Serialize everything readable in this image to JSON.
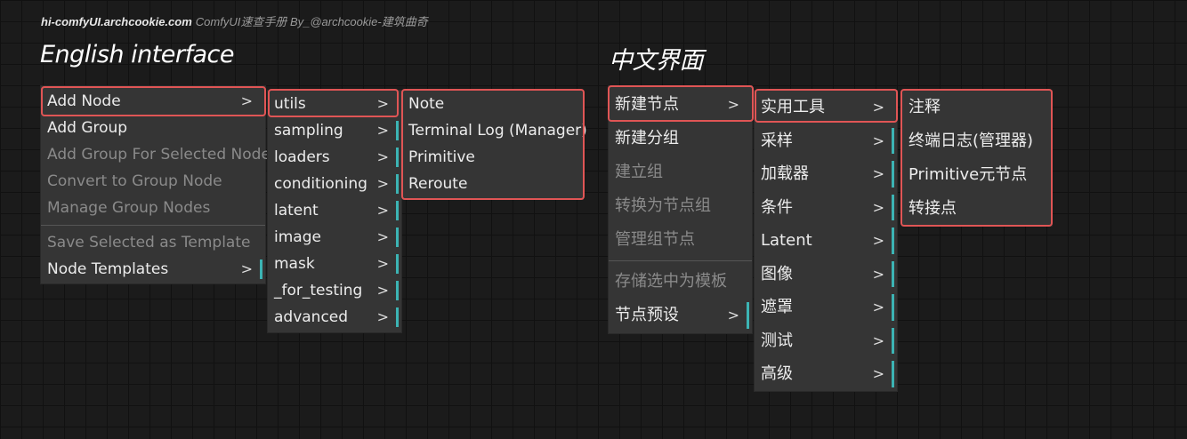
{
  "watermark": {
    "site": "hi-comfyUI.archcookie.com",
    "text": "ComfyUI速查手册 By_@archcookie-建筑曲奇"
  },
  "english": {
    "title": "English interface",
    "main_menu": [
      {
        "label": "Add Node",
        "submenu": true,
        "disabled": false
      },
      {
        "label": "Add Group",
        "submenu": false,
        "disabled": false
      },
      {
        "label": "Add Group For Selected Nodes",
        "submenu": false,
        "disabled": true
      },
      {
        "label": "Convert to Group Node",
        "submenu": false,
        "disabled": true
      },
      {
        "label": "Manage Group Nodes",
        "submenu": false,
        "disabled": true
      },
      {
        "label": "Save Selected as Template",
        "submenu": false,
        "disabled": true
      },
      {
        "label": "Node Templates",
        "submenu": true,
        "disabled": false
      }
    ],
    "category_menu": [
      "utils",
      "sampling",
      "loaders",
      "conditioning",
      "latent",
      "image",
      "mask",
      "_for_testing",
      "advanced"
    ],
    "utils_menu": [
      "Note",
      "Terminal Log (Manager)",
      "Primitive",
      "Reroute"
    ]
  },
  "chinese": {
    "title": "中文界面",
    "main_menu": [
      {
        "label": "新建节点",
        "submenu": true,
        "disabled": false
      },
      {
        "label": "新建分组",
        "submenu": false,
        "disabled": false
      },
      {
        "label": "建立组",
        "submenu": false,
        "disabled": true
      },
      {
        "label": "转换为节点组",
        "submenu": false,
        "disabled": true
      },
      {
        "label": "管理组节点",
        "submenu": false,
        "disabled": true
      },
      {
        "label": "存储选中为模板",
        "submenu": false,
        "disabled": true
      },
      {
        "label": "节点预设",
        "submenu": true,
        "disabled": false
      }
    ],
    "category_menu": [
      "实用工具",
      "采样",
      "加载器",
      "条件",
      "Latent",
      "图像",
      "遮罩",
      "测试",
      "高级"
    ],
    "utils_menu": [
      "注释",
      "终端日志(管理器)",
      "Primitive元节点",
      "转接点"
    ]
  },
  "arrow_glyph": ">",
  "colors": {
    "highlight": "#e05555",
    "accent_bar": "#3cb4b4",
    "menu_bg": "#353535",
    "disabled_text": "#8a8a8a"
  }
}
